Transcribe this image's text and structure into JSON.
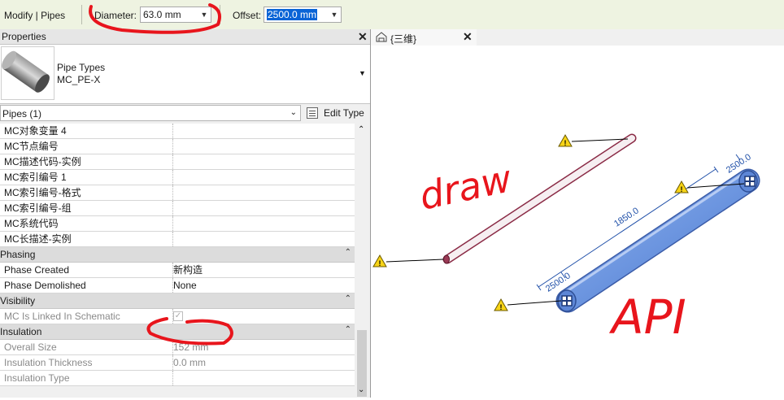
{
  "options_bar": {
    "context": "Modify | Pipes",
    "diameter_label": "Diameter:",
    "diameter_value": "63.0 mm",
    "offset_label": "Offset:",
    "offset_value": "2500.0 mm"
  },
  "properties": {
    "title": "Properties",
    "type_family": "Pipe Types",
    "type_name": "MC_PE-X",
    "filter": "Pipes (1)",
    "edit_type": "Edit Type",
    "rows": [
      {
        "label": "MC对象变量 4",
        "value": ""
      },
      {
        "label": "MC节点编号",
        "value": ""
      },
      {
        "label": "MC描述代码-实例",
        "value": ""
      },
      {
        "label": "MC索引编号 1",
        "value": ""
      },
      {
        "label": "MC索引编号-格式",
        "value": ""
      },
      {
        "label": "MC索引编号-组",
        "value": ""
      },
      {
        "label": "MC系统代码",
        "value": ""
      },
      {
        "label": "MC长描述-实例",
        "value": ""
      }
    ],
    "phasing": {
      "title": "Phasing",
      "phase_created_label": "Phase Created",
      "phase_created_value": "新构造",
      "phase_demolished_label": "Phase Demolished",
      "phase_demolished_value": "None"
    },
    "visibility": {
      "title": "Visibility",
      "linked_label": "MC Is Linked In Schematic"
    },
    "insulation": {
      "title": "Insulation",
      "overall_size_label": "Overall Size",
      "overall_size_value": "152 mm",
      "thickness_label": "Insulation Thickness",
      "thickness_value": "0.0 mm",
      "type_label": "Insulation Type",
      "type_value": ""
    }
  },
  "view": {
    "tab_title": "{三维}",
    "dim_top": "2500.0",
    "dim_length": "1850.0",
    "dim_bottom": "2500.0",
    "annotation_draw": "draw",
    "annotation_api": "API"
  },
  "colors": {
    "options_bar_bg": "#eef3e1",
    "selection": "#0a64d6",
    "dimension": "#1f4fa8",
    "annotation_red": "#e8151c",
    "warning_yellow": "#f7d417",
    "blue_pipe": "#6d96e0"
  }
}
